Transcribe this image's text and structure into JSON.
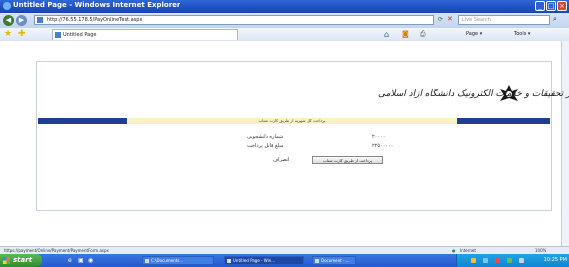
{
  "window": {
    "title": "Untitled Page - Windows Internet Explorer",
    "minimize_icon": "minimize-icon",
    "maximize_icon": "maximize-icon",
    "close_icon": "close-icon"
  },
  "navigation": {
    "address": "http://76.55.178.5/PayOnlineTest.aspx",
    "search_placeholder": "Live Search",
    "back_icon": "back-arrow-icon",
    "forward_icon": "forward-arrow-icon",
    "refresh_icon": "refresh-icon",
    "stop_icon": "stop-icon",
    "search_icon": "search-icon"
  },
  "tabs": [
    {
      "label": "Untitled Page",
      "icon": "page-icon"
    }
  ],
  "command_bar": {
    "home_icon": "home-icon",
    "feeds_icon": "rss-icon",
    "print_icon": "print-icon",
    "page_label": "Page",
    "tools_label": "Tools"
  },
  "page": {
    "banner_title": "مرکز تحقیقات و خدمات الکترونیک دانشگاه آزاد اسلامی",
    "notice": "پرداخت کل شهریه از طریق کارت شتاب",
    "fields": [
      {
        "label": "شماره دانشجویی",
        "value": "۲۰۰۰۰"
      },
      {
        "label": "مبلغ قابل پرداخت",
        "value": "۲۲۵۰۰۰۰۰"
      }
    ],
    "status_label": "انصراف",
    "pay_button": "پرداخت از طریق کارت شتاب"
  },
  "status_bar": {
    "text": "https://payment/Online/Payment/PaymentForm.aspx",
    "zone": "Internet",
    "zoom": "100%"
  },
  "taskbar": {
    "start_label": "start",
    "items": [
      {
        "label": "C:\\Documents..."
      },
      {
        "label": "Untitled Page - Win..."
      },
      {
        "label": "Document - ..."
      }
    ],
    "clock": "10:25 PM"
  },
  "colors": {
    "titlebar": "#2458cf",
    "banner_bar": "#1f3f94",
    "notice_bg": "#f9f3c4",
    "start_button": "#3a9b36"
  }
}
